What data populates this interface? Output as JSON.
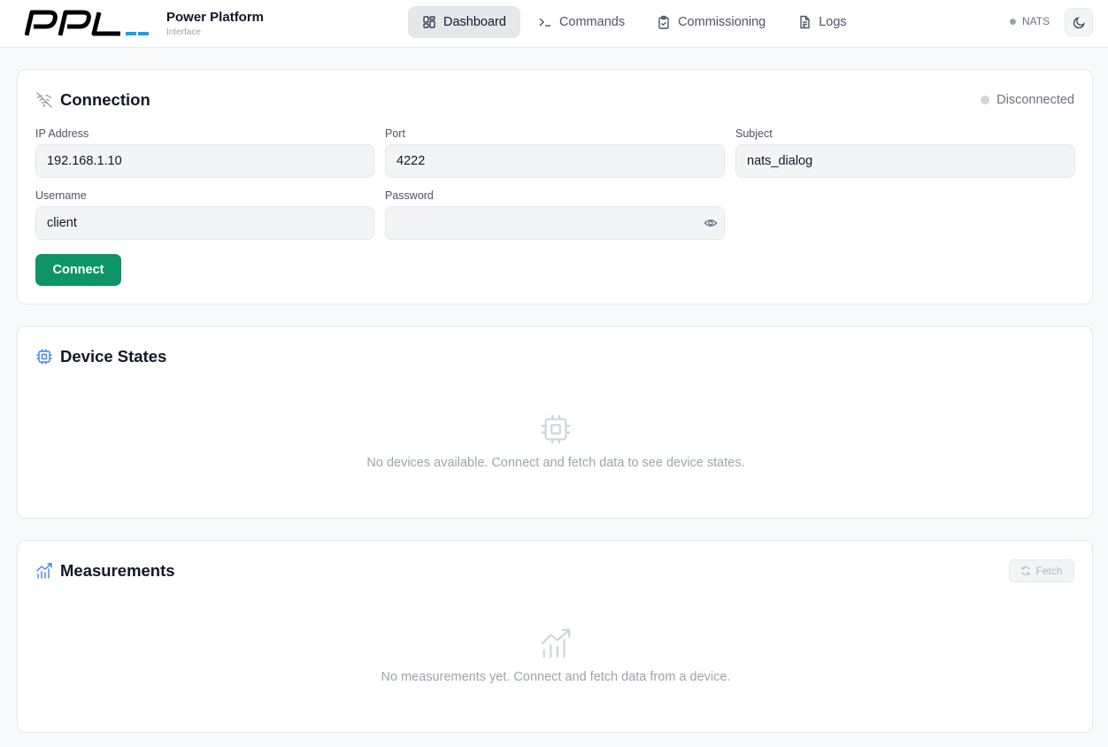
{
  "brand": {
    "title": "Power Platform",
    "subtitle": "Interface",
    "logo_text": "PPL"
  },
  "nav": {
    "items": [
      {
        "label": "Dashboard",
        "icon": "dashboard-grid-icon",
        "active": true
      },
      {
        "label": "Commands",
        "icon": "terminal-icon",
        "active": false
      },
      {
        "label": "Commissioning",
        "icon": "clipboard-check-icon",
        "active": false
      },
      {
        "label": "Logs",
        "icon": "document-icon",
        "active": false
      }
    ]
  },
  "header_status": {
    "label": "NATS"
  },
  "theme_toggle": {
    "icon": "moon-icon"
  },
  "connection": {
    "title": "Connection",
    "status": "Disconnected",
    "fields": {
      "ip": {
        "label": "IP Address",
        "value": "192.168.1.10"
      },
      "port": {
        "label": "Port",
        "value": "4222"
      },
      "subject": {
        "label": "Subject",
        "value": "nats_dialog"
      },
      "username": {
        "label": "Username",
        "value": "client"
      },
      "password": {
        "label": "Password",
        "value": ""
      }
    },
    "connect_label": "Connect"
  },
  "devices": {
    "title": "Device States",
    "empty_text": "No devices available. Connect and fetch data to see device states."
  },
  "measurements": {
    "title": "Measurements",
    "fetch_label": "Fetch",
    "empty_text": "No measurements yet. Connect and fetch data from a device."
  },
  "colors": {
    "accent_green": "#0d9565",
    "icon_blue": "#3b82f6",
    "logo_blue": "#1d9bf0"
  }
}
